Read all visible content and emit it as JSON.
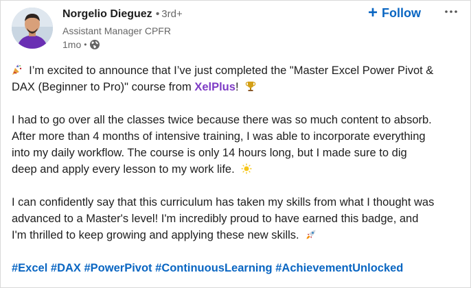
{
  "author": {
    "name": "Norgelio Dieguez",
    "separator": "•",
    "degree": "3rd+",
    "headline": "Assistant Manager CPFR",
    "time": "1mo",
    "meta_dot": "•",
    "avatar_icon": "profile-photo",
    "visibility_icon": "globe-icon"
  },
  "actions": {
    "follow_plus": "+",
    "follow_label": "Follow",
    "more_icon": "more-options-icon"
  },
  "post": {
    "p1_before": "I’m excited to announce that I’ve just completed the \"Master Excel Power Pivot &",
    "p1_line2": "DAX (Beginner to Pro)\" course from",
    "mention": "XelPlus",
    "mention_after": "!",
    "p2_lines": [
      "I had to go over all the classes twice because there was so much content to absorb.",
      "After more than 4 months of intensive training, I was able to incorporate everything",
      "into my daily workflow. The course is only 14 hours long, but I made sure to dig",
      "deep and apply every lesson to my work life."
    ],
    "p3_lines": [
      "I can confidently say that this curriculum has taken my skills from what I thought was",
      "advanced to a Master's level! I'm incredibly proud to have earned this badge, and",
      "I'm thrilled to keep growing and applying these new skills."
    ],
    "emojis": [
      "party-popper-icon",
      "trophy-icon",
      "sparkle-sun-icon",
      "rocket-icon"
    ],
    "hashtags": [
      "#Excel",
      "#DAX",
      "#PowerPivot",
      "#ContinuousLearning",
      "#AchievementUnlocked"
    ]
  },
  "colors": {
    "link": "#0a66c2",
    "mention": "#7e3cc5",
    "text": "#1d1d1d",
    "muted": "#666666"
  }
}
